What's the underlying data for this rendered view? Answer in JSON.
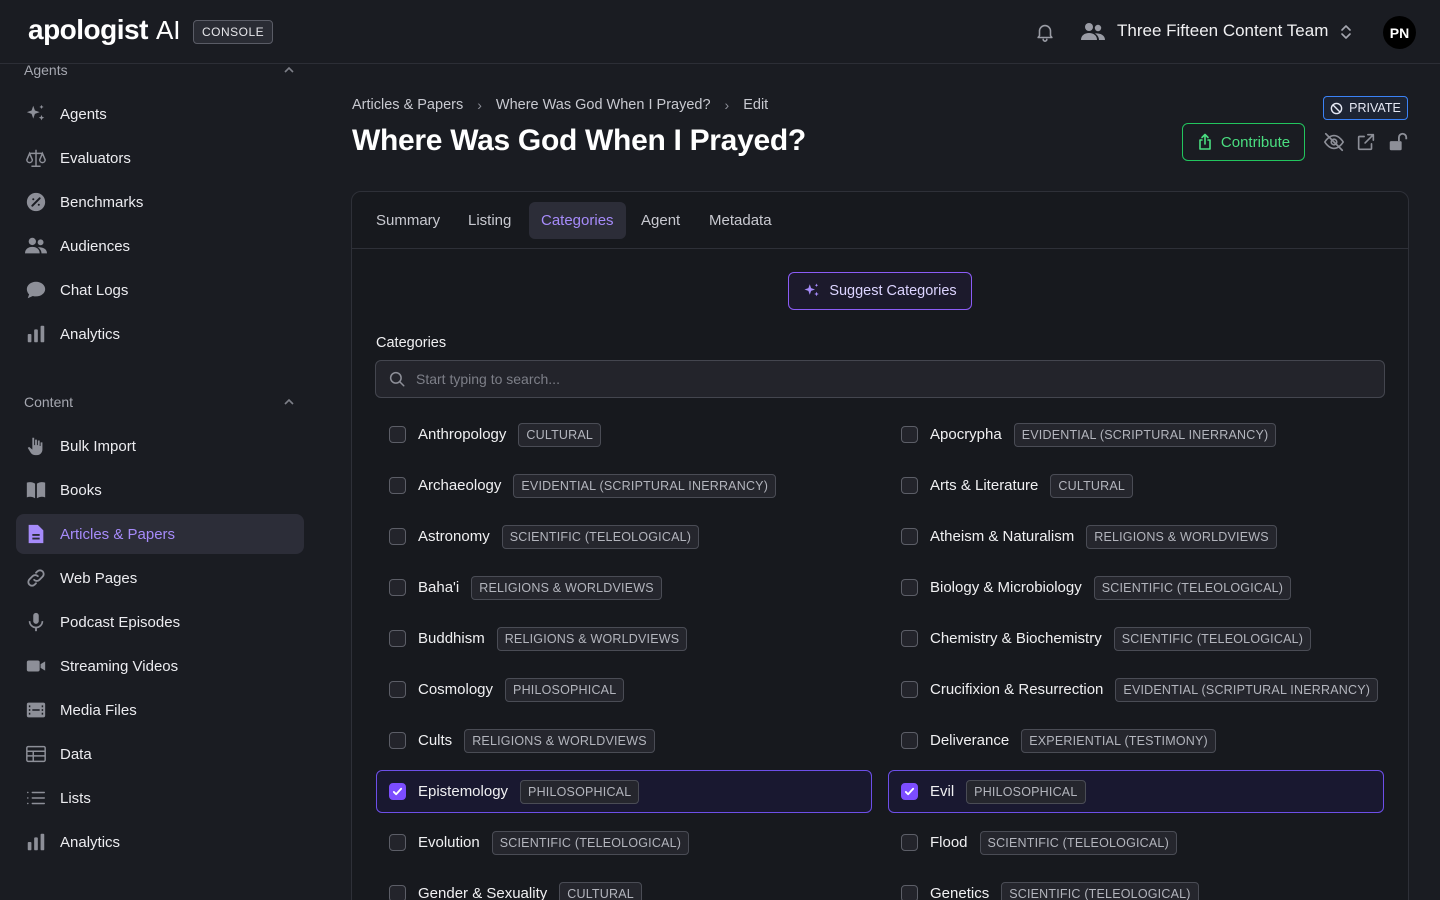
{
  "header": {
    "logo_text": "apologist",
    "logo_ai": "AI",
    "console_label": "CONSOLE",
    "team_name": "Three Fifteen Content Team",
    "avatar_initials": "PN"
  },
  "sidebar": {
    "agents_section": "Agents",
    "agents_items": [
      {
        "label": "Agents",
        "icon": "sparkles-icon"
      },
      {
        "label": "Evaluators",
        "icon": "scale-icon"
      },
      {
        "label": "Benchmarks",
        "icon": "gauge-icon"
      },
      {
        "label": "Audiences",
        "icon": "users-icon"
      },
      {
        "label": "Chat Logs",
        "icon": "chat-icon"
      },
      {
        "label": "Analytics",
        "icon": "bar-chart-icon"
      }
    ],
    "content_section": "Content",
    "content_items": [
      {
        "label": "Bulk Import",
        "icon": "hand-icon"
      },
      {
        "label": "Books",
        "icon": "book-icon"
      },
      {
        "label": "Articles & Papers",
        "icon": "document-icon",
        "active": true
      },
      {
        "label": "Web Pages",
        "icon": "link-icon"
      },
      {
        "label": "Podcast Episodes",
        "icon": "microphone-icon"
      },
      {
        "label": "Streaming Videos",
        "icon": "video-icon"
      },
      {
        "label": "Media Files",
        "icon": "film-icon"
      },
      {
        "label": "Data",
        "icon": "table-icon"
      },
      {
        "label": "Lists",
        "icon": "list-icon"
      },
      {
        "label": "Analytics",
        "icon": "bar-chart-icon"
      }
    ]
  },
  "breadcrumb": [
    "Articles & Papers",
    "Where Was God When I Prayed?",
    "Edit"
  ],
  "page_title": "Where Was God When I Prayed?",
  "private_label": "PRIVATE",
  "contribute_label": "Contribute",
  "tabs": [
    {
      "label": "Summary"
    },
    {
      "label": "Listing"
    },
    {
      "label": "Categories",
      "active": true
    },
    {
      "label": "Agent"
    },
    {
      "label": "Metadata"
    }
  ],
  "suggest_label": "Suggest Categories",
  "categories_label": "Categories",
  "search_placeholder": "Start typing to search...",
  "categories": [
    {
      "name": "Anthropology",
      "tag": "CULTURAL",
      "checked": false
    },
    {
      "name": "Apocrypha",
      "tag": "EVIDENTIAL (SCRIPTURAL INERRANCY)",
      "checked": false
    },
    {
      "name": "Archaeology",
      "tag": "EVIDENTIAL (SCRIPTURAL INERRANCY)",
      "checked": false
    },
    {
      "name": "Arts & Literature",
      "tag": "CULTURAL",
      "checked": false
    },
    {
      "name": "Astronomy",
      "tag": "SCIENTIFIC (TELEOLOGICAL)",
      "checked": false
    },
    {
      "name": "Atheism & Naturalism",
      "tag": "RELIGIONS & WORLDVIEWS",
      "checked": false
    },
    {
      "name": "Baha'i",
      "tag": "RELIGIONS & WORLDVIEWS",
      "checked": false
    },
    {
      "name": "Biology & Microbiology",
      "tag": "SCIENTIFIC (TELEOLOGICAL)",
      "checked": false
    },
    {
      "name": "Buddhism",
      "tag": "RELIGIONS & WORLDVIEWS",
      "checked": false
    },
    {
      "name": "Chemistry & Biochemistry",
      "tag": "SCIENTIFIC (TELEOLOGICAL)",
      "checked": false
    },
    {
      "name": "Cosmology",
      "tag": "PHILOSOPHICAL",
      "checked": false
    },
    {
      "name": "Crucifixion & Resurrection",
      "tag": "EVIDENTIAL (SCRIPTURAL INERRANCY)",
      "checked": false
    },
    {
      "name": "Cults",
      "tag": "RELIGIONS & WORLDVIEWS",
      "checked": false
    },
    {
      "name": "Deliverance",
      "tag": "EXPERIENTIAL (TESTIMONY)",
      "checked": false
    },
    {
      "name": "Epistemology",
      "tag": "PHILOSOPHICAL",
      "checked": true
    },
    {
      "name": "Evil",
      "tag": "PHILOSOPHICAL",
      "checked": true
    },
    {
      "name": "Evolution",
      "tag": "SCIENTIFIC (TELEOLOGICAL)",
      "checked": false
    },
    {
      "name": "Flood",
      "tag": "SCIENTIFIC (TELEOLOGICAL)",
      "checked": false
    },
    {
      "name": "Gender & Sexuality",
      "tag": "CULTURAL",
      "checked": false
    },
    {
      "name": "Genetics",
      "tag": "SCIENTIFIC (TELEOLOGICAL)",
      "checked": false
    }
  ]
}
